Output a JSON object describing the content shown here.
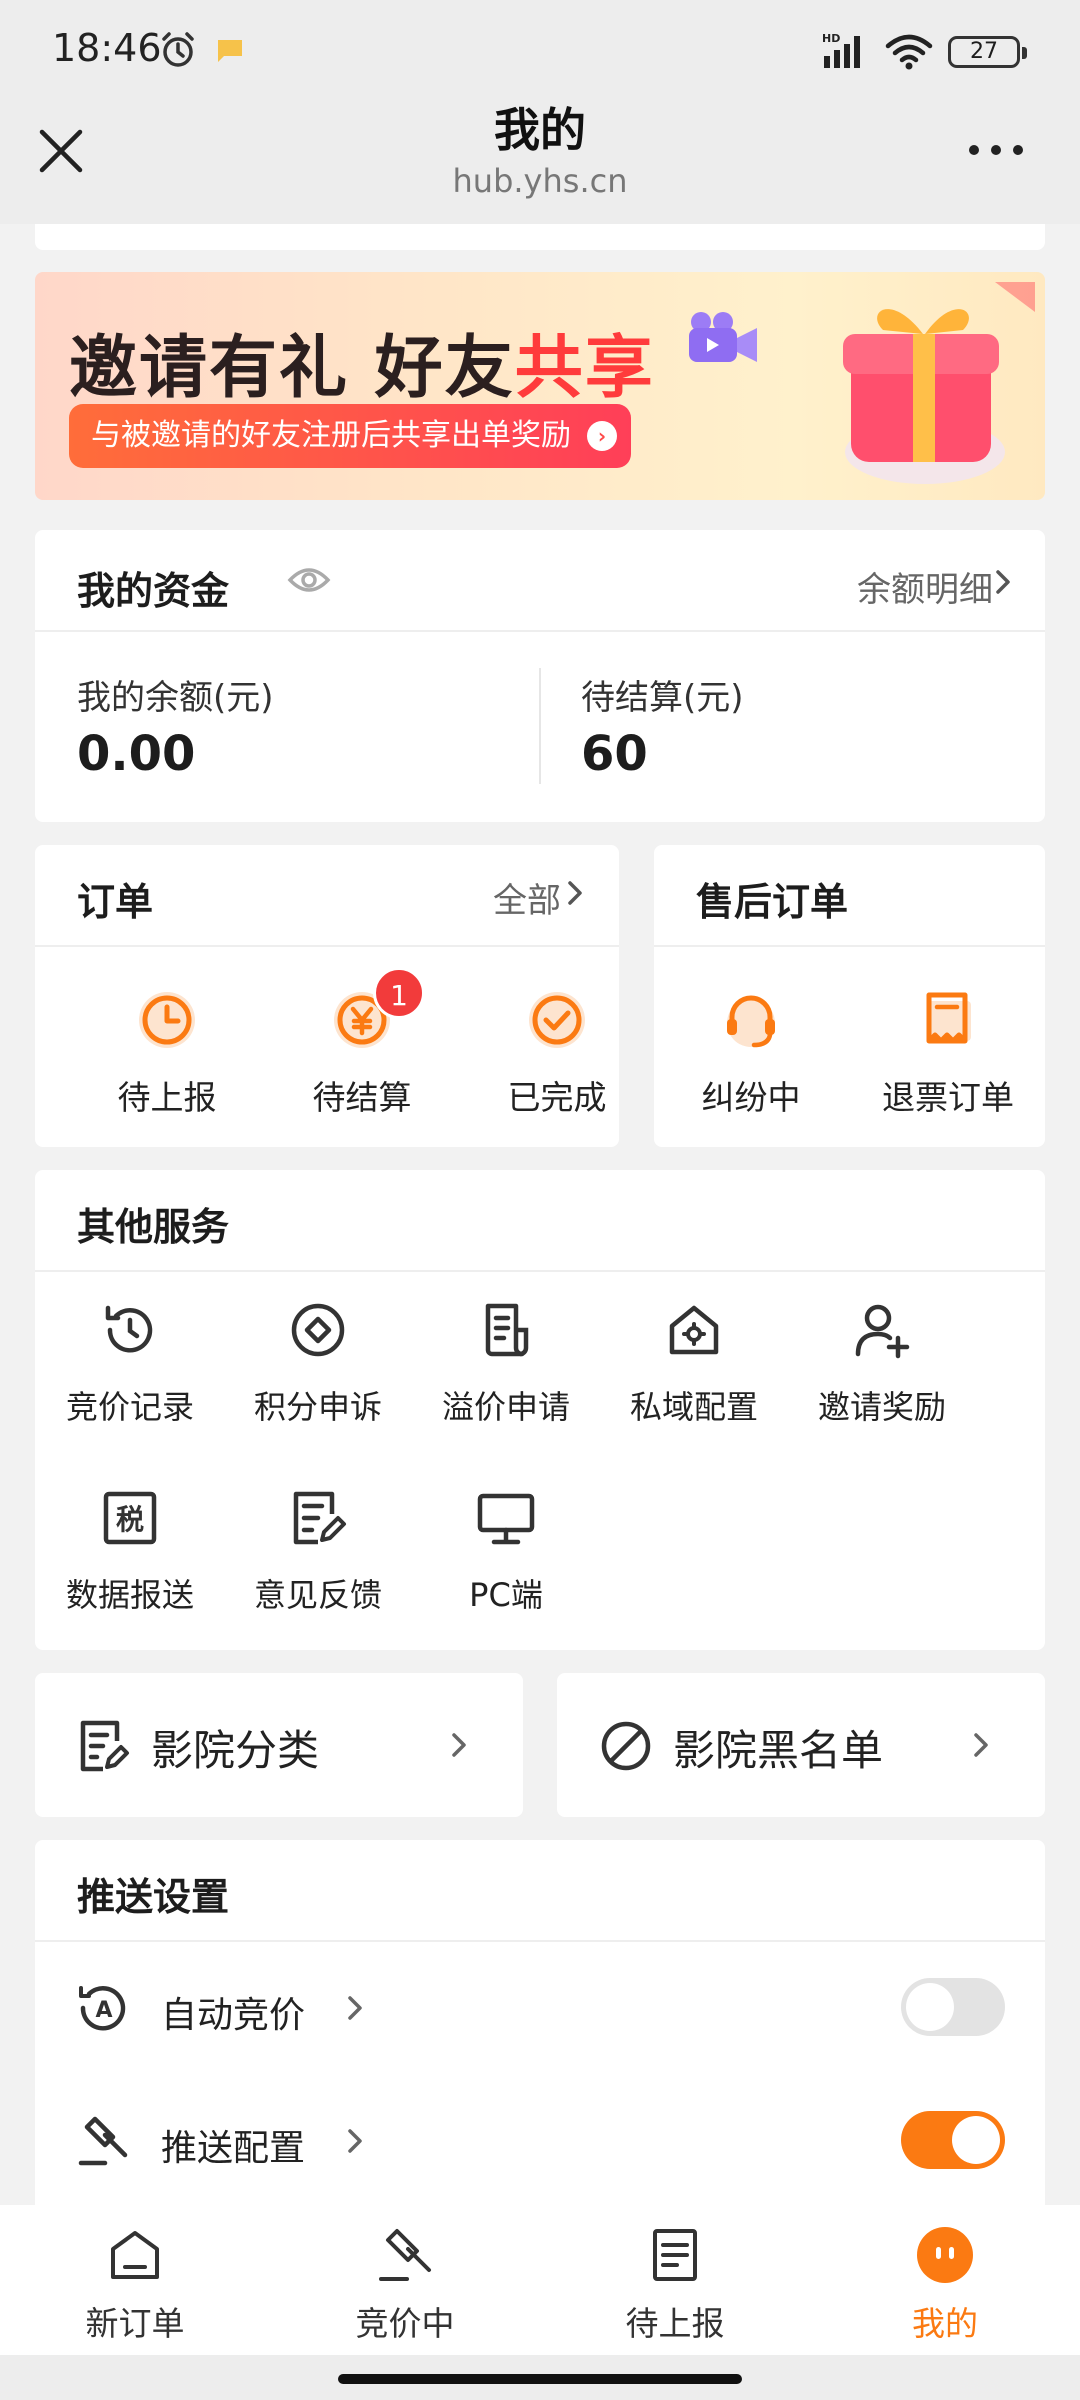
{
  "status_bar": {
    "time": "18:46",
    "battery": "27"
  },
  "title_bar": {
    "title": "我的",
    "subtitle": "hub.yhs.cn"
  },
  "banner": {
    "headline_main": "邀请有礼 好友",
    "headline_highlight": "共享",
    "subline": "与被邀请的好友注册后共享出单奖励"
  },
  "funds": {
    "title": "我的资金",
    "detail_link": "余额明细",
    "balance_label": "我的余额(元)",
    "balance_value": "0.00",
    "pending_label": "待结算(元)",
    "pending_value": "60"
  },
  "orders": {
    "title": "订单",
    "all_link": "全部",
    "items": [
      {
        "label": "待上报",
        "icon": "clock-icon"
      },
      {
        "label": "待结算",
        "icon": "yen-icon",
        "badge": "1"
      },
      {
        "label": "已完成",
        "icon": "check-circle-icon"
      }
    ]
  },
  "after_sale": {
    "title": "售后订单",
    "items": [
      {
        "label": "纠纷中",
        "icon": "headset-icon"
      },
      {
        "label": "退票订单",
        "icon": "receipt-icon"
      }
    ]
  },
  "services": {
    "title": "其他服务",
    "items": [
      {
        "label": "竞价记录",
        "icon": "history-icon"
      },
      {
        "label": "积分申诉",
        "icon": "diamond-icon"
      },
      {
        "label": "溢价申请",
        "icon": "document-icon"
      },
      {
        "label": "私域配置",
        "icon": "home-gear-icon"
      },
      {
        "label": "邀请奖励",
        "icon": "user-add-icon"
      },
      {
        "label": "数据报送",
        "icon": "tax-icon"
      },
      {
        "label": "意见反馈",
        "icon": "edit-doc-icon"
      },
      {
        "label": "PC端",
        "icon": "monitor-icon"
      }
    ]
  },
  "cinema": {
    "category_label": "影院分类",
    "blacklist_label": "影院黑名单"
  },
  "push": {
    "title": "推送设置",
    "auto_bid_label": "自动竞价",
    "auto_bid_on": false,
    "push_config_label": "推送配置",
    "push_config_on": true
  },
  "tabs": [
    {
      "label": "新订单",
      "icon": "home-icon"
    },
    {
      "label": "竞价中",
      "icon": "gavel-icon"
    },
    {
      "label": "待上报",
      "icon": "report-icon"
    },
    {
      "label": "我的",
      "icon": "profile-icon",
      "active": true
    }
  ],
  "colors": {
    "accent": "#fb7a12",
    "badge": "#f23b3b"
  }
}
